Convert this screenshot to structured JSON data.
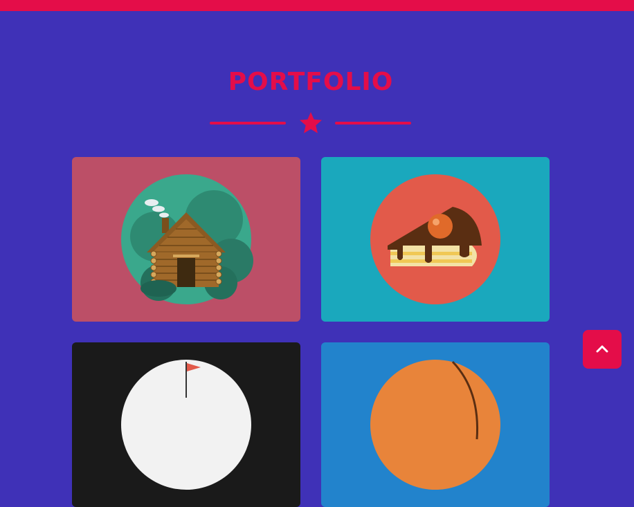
{
  "header": {
    "accent_color": "#e40d49"
  },
  "portfolio": {
    "title": "PORTFOLIO",
    "divider_icon": "star-icon",
    "items": [
      {
        "name": "log-cabin",
        "icon": "log-cabin-illustration",
        "bg_color": "#bc4f67"
      },
      {
        "name": "cake-slice",
        "icon": "cake-slice-illustration",
        "bg_color": "#1aa8bd"
      },
      {
        "name": "golf-flag",
        "icon": "golf-flag-illustration",
        "bg_color": "#1a1a1a"
      },
      {
        "name": "basketball",
        "icon": "basketball-illustration",
        "bg_color": "#2283cc"
      }
    ]
  },
  "scroll_top": {
    "icon": "chevron-up-icon"
  },
  "colors": {
    "page_bg": "#3f31b7",
    "accent": "#e40d49"
  }
}
